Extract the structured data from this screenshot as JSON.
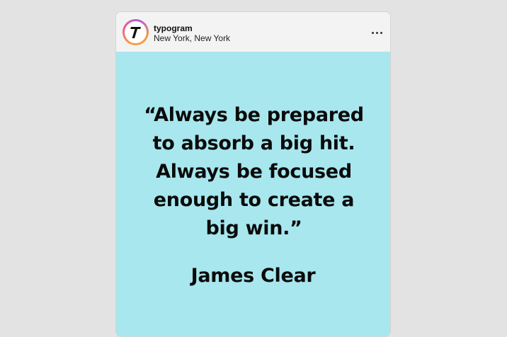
{
  "post": {
    "account_name": "typogram",
    "location": "New York, New York",
    "avatar_icon": "typogram-logo-icon",
    "more_icon": "more-options-icon",
    "image": {
      "background_color": "#a8e7ee",
      "quote": "“Always be prepared\nto absorb a big hit.\nAlways be focused\nenough to create a\nbig win.”",
      "author": "James Clear"
    }
  }
}
